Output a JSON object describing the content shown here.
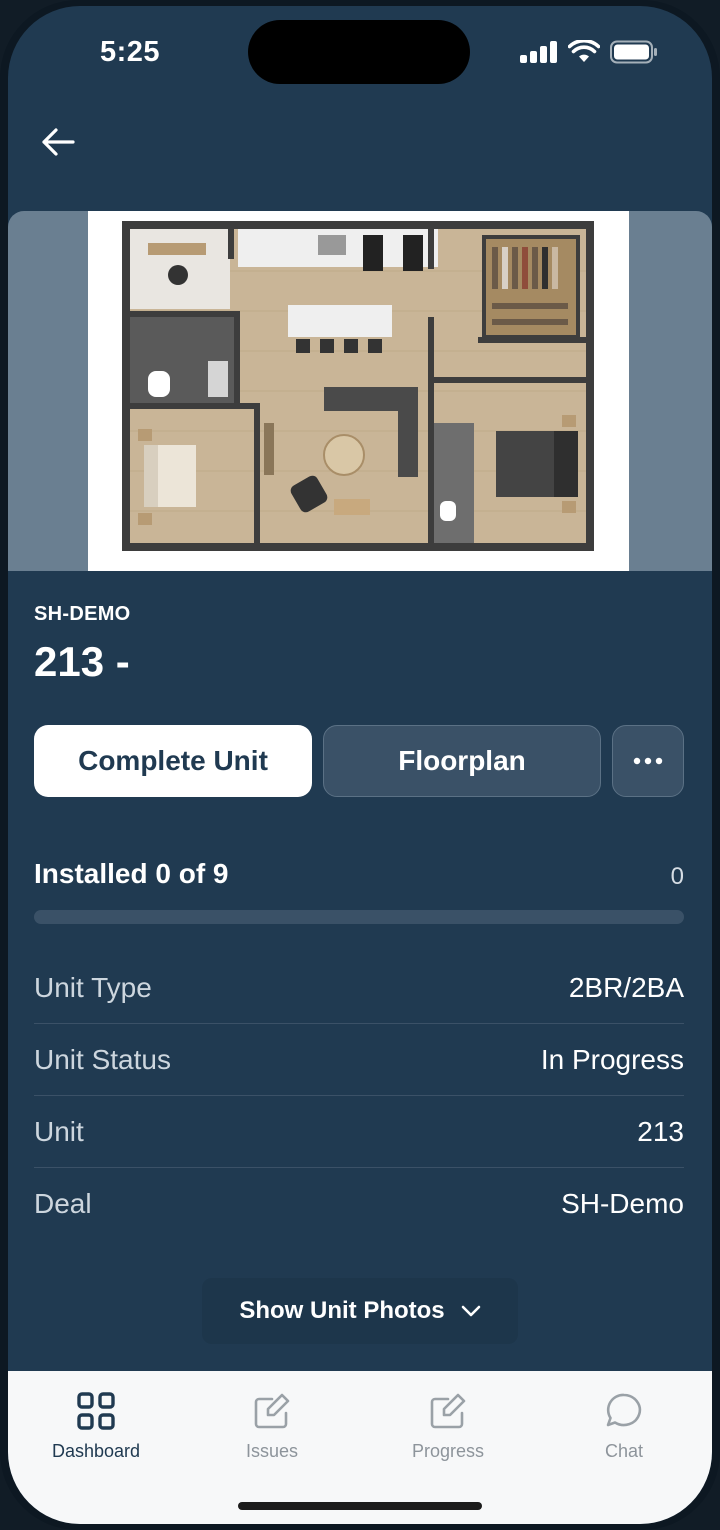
{
  "status_bar": {
    "time": "5:25"
  },
  "header": {
    "back_icon": "arrow-left-icon"
  },
  "unit": {
    "project_code": "SH-DEMO",
    "title": "213 -"
  },
  "actions": {
    "complete_label": "Complete Unit",
    "floorplan_label": "Floorplan",
    "more_icon": "more-horizontal-icon"
  },
  "progress": {
    "label": "Installed 0 of 9",
    "count": "0",
    "fraction": 0
  },
  "details": [
    {
      "label": "Unit Type",
      "value": "2BR/2BA"
    },
    {
      "label": "Unit Status",
      "value": "In Progress"
    },
    {
      "label": "Unit",
      "value": "213"
    },
    {
      "label": "Deal",
      "value": "SH-Demo"
    }
  ],
  "photos_button": {
    "label": "Show Unit Photos",
    "icon": "chevron-down-icon"
  },
  "tabbar": {
    "tabs": [
      {
        "label": "Dashboard",
        "icon": "grid-icon",
        "active": true
      },
      {
        "label": "Issues",
        "icon": "edit-icon",
        "active": false
      },
      {
        "label": "Progress",
        "icon": "edit-icon",
        "active": false
      },
      {
        "label": "Chat",
        "icon": "chat-bubble-icon",
        "active": false
      }
    ]
  },
  "colors": {
    "background": "#203a51",
    "secondary_button": "#3a5167",
    "tabbar": "#f7f8f9"
  }
}
